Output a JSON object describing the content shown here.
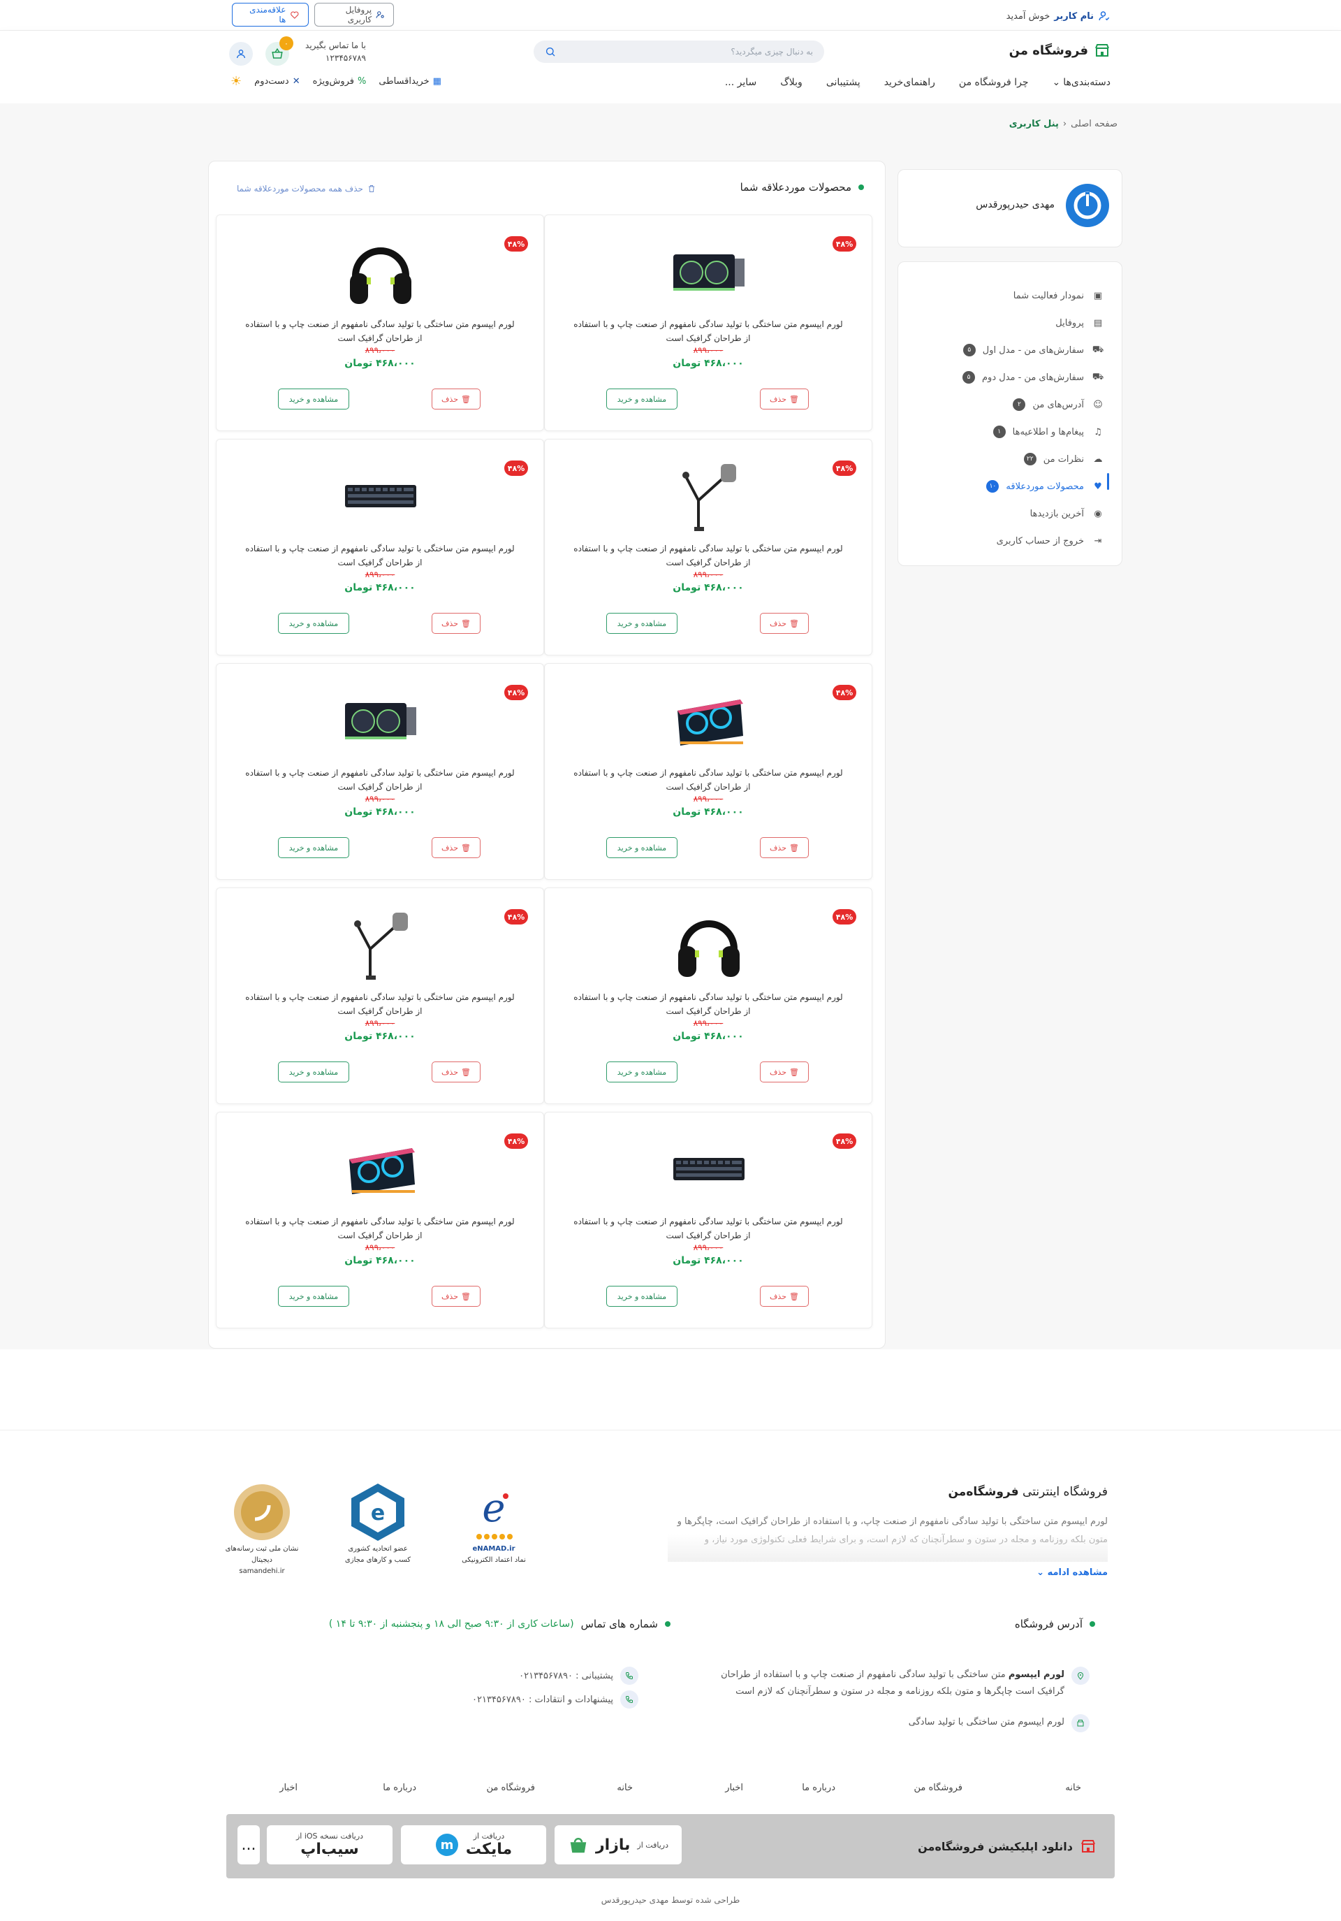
{
  "topbar": {
    "welcome_name": "نام کاربر",
    "welcome_text": "خوش آمدید",
    "profile_btn": "پروفایل کاربری",
    "fav_btn": "علاقه‌مندی ها"
  },
  "header": {
    "logo": "فروشگاه من",
    "search_placeholder": "به دنبال چیزی میگردید؟",
    "contact_label": "با ما تماس بگیرید",
    "contact_phone": "۱۲۳۴۵۶۷۸۹",
    "cart_count": "۰",
    "nav": [
      "دسته‌بندی‌ها",
      "چرا فروشگاه من",
      "راهنمای‌خرید",
      "پشتیبانی",
      "وبلاگ",
      "سایر ..."
    ],
    "sub_nav": [
      "خریداقساطی",
      "فروش‌ویژه",
      "دست‌دوم"
    ]
  },
  "breadcrumb": {
    "home": "صفحه اصلی",
    "current": "پنل کاربری"
  },
  "profile": {
    "name": "مهدی حیدرپورقدس"
  },
  "menu": [
    {
      "label": "نمودار فعالیت شما",
      "count": ""
    },
    {
      "label": "پروفایل",
      "count": ""
    },
    {
      "label": "سفارش‌های من - مدل اول",
      "count": "۵"
    },
    {
      "label": "سفارش‌های من - مدل دوم",
      "count": "۵"
    },
    {
      "label": "آدرس‌های من",
      "count": "۲"
    },
    {
      "label": "پیغام‌ها و اطلاعیه‌ها",
      "count": "۱"
    },
    {
      "label": "نظرات من",
      "count": "۲۲"
    },
    {
      "label": "محصولات موردعلاقه",
      "count": "۱۰"
    },
    {
      "label": "آخرین بازدیدها",
      "count": ""
    },
    {
      "label": "خروج از حساب کاربری",
      "count": ""
    }
  ],
  "wishlist": {
    "title": "محصولات موردعلاقه شما",
    "delete_all": "حذف همه محصولات موردعلاقه شما",
    "product_desc": "لورم ایپسوم متن ساختگی با تولید سادگی نامفهوم از صنعت چاپ و با استفاده از طراحان گرافیک است",
    "old_price": "۸۹۹،۰۰۰",
    "price": "۴۶۸،۰۰۰ تومان",
    "discount": "۴۸%",
    "delete_btn": "حذف",
    "buy_btn": "مشاهده و خرید",
    "products": [
      {
        "image": "graphics-card-icon"
      },
      {
        "image": "headphones-icon"
      },
      {
        "image": "microphone-arm-icon"
      },
      {
        "image": "keyboard-icon"
      },
      {
        "image": "cooling-pad-icon"
      },
      {
        "image": "graphics-card-icon"
      },
      {
        "image": "headphones-icon"
      },
      {
        "image": "microphone-arm-icon"
      },
      {
        "image": "keyboard-icon"
      },
      {
        "image": "cooling-pad-icon"
      }
    ]
  },
  "footer": {
    "title_prefix": "فروشگاه اینترنتی",
    "title_brand": "فروشگاه‌من",
    "about_text": "لورم ایپسوم متن ساختگی با تولید سادگی نامفهوم از صنعت چاپ، و با استفاده از طراحان گرافیک است، چاپگرها و متون بلکه روزنامه و مجله در ستون و سطرآنچنان که لازم است، و برای شرایط فعلی تکنولوژی مورد نیاز، و کاربردهای متنوع با هدف",
    "more": "مشاهده ادامه",
    "badges": [
      {
        "title": "samandehi.ir",
        "caption": "نشان ملی ثبت رسانه‌های دیجیتال"
      },
      {
        "title": "عضو اتحادیه کشوری",
        "caption": "کسب و کارهای مجازی"
      },
      {
        "title": "eNAMAD.ir",
        "caption": "نماد اعتماد الکترونیکی"
      }
    ],
    "address_heading": "آدرس فروشگاه",
    "address_bold": "لورم ایپسوم",
    "address_text": "متن ساختگی با تولید سادگی نامفهوم از صنعت چاپ و با استفاده از طراحان گرافیک است چاپگرها و متون بلکه روزنامه و مجله در ستون و سطرآنچنان که لازم است",
    "address_line2": "لورم ایپسوم متن ساختگی با تولید سادگی",
    "phones_heading": "شماره های تماس",
    "hours": "(ساعات کاری از ۹:۳۰ صبح الی ۱۸ و پنجشنبه از ۹:۳۰ تا ۱۴ )",
    "support_phone": "پشتیبانی : ۰۲۱۳۴۵۶۷۸۹۰",
    "suggest_phone": "پیشنهادات و انتقادات : ۰۲۱۳۴۵۶۷۸۹۰",
    "links_right": [
      "خانه",
      "فروشگاه من",
      "درباره ما",
      "اخبار"
    ],
    "links_left": [
      "خانه",
      "فروشگاه من",
      "درباره ما",
      "اخبار"
    ],
    "app_title": "دانلود اپلیکیشن فروشگاه‌من",
    "store_bazaar_small": "دریافت از",
    "store_bazaar": "بازار",
    "store_myket_small": "دریافت از",
    "store_myket": "مایکت",
    "store_sib_small": "دریافت نسخه iOS از",
    "store_sib": "سیب‌اپ",
    "more_dots": "...",
    "credit": "طراحی شده توسط مهدی حیدرپورقدس"
  },
  "colors": {
    "accent": "#1f6fe0",
    "success": "#1a9a50",
    "danger": "#e52b2b"
  }
}
